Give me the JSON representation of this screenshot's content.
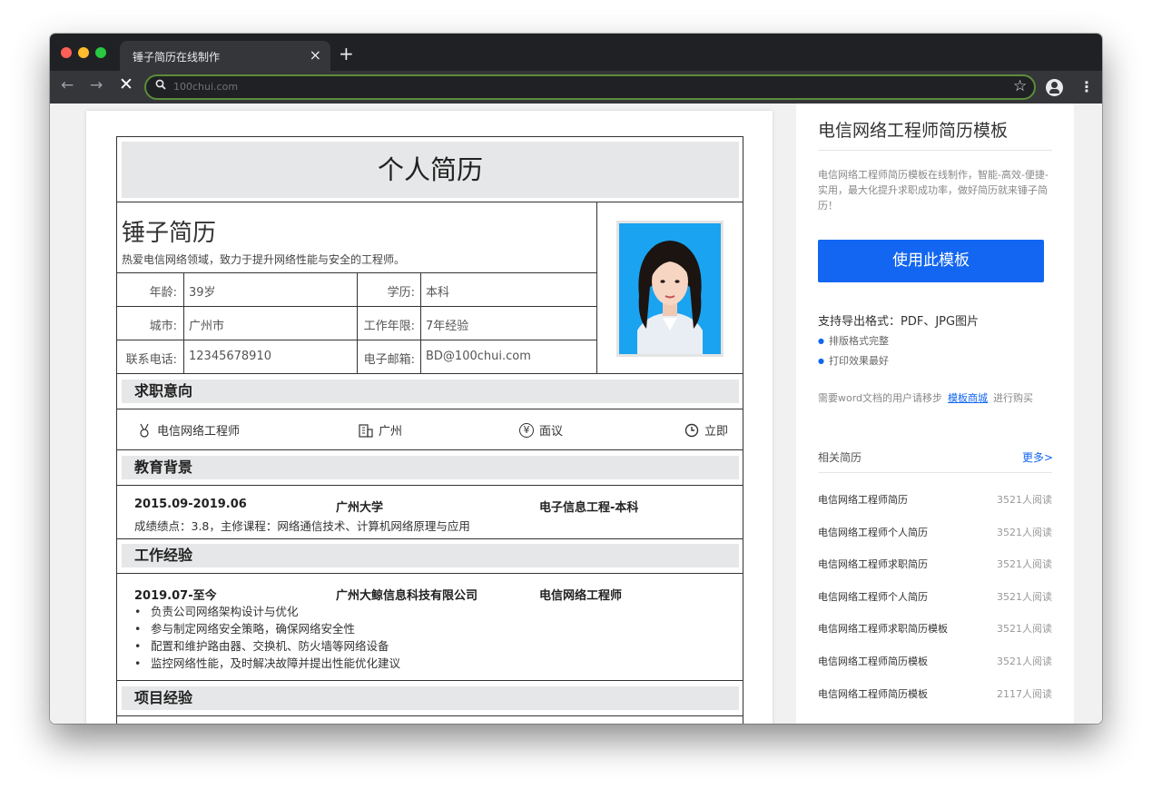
{
  "browser": {
    "tab_title": "锤子简历在线制作",
    "tab_close": "×",
    "new_tab": "+",
    "back": "←",
    "forward": "→",
    "stop": "✕",
    "search_glyph": "🔍",
    "url": "100chui.com",
    "star": "☆",
    "menu": "⋮"
  },
  "resume": {
    "title": "个人简历",
    "name": "锤子简历",
    "motto": "热爱电信网络领域，致力于提升网络性能与安全的工程师。",
    "info": [
      {
        "label": "年龄:",
        "value": "39岁"
      },
      {
        "label": "学历:",
        "value": "本科"
      },
      {
        "label": "城市:",
        "value": "广州市"
      },
      {
        "label": "工作年限:",
        "value": "7年经验"
      },
      {
        "label": "联系电话:",
        "value": "12345678910"
      },
      {
        "label": "电子邮箱:",
        "value": "BD@100chui.com"
      }
    ],
    "sections": {
      "intent": "求职意向",
      "education": "教育背景",
      "work": "工作经验",
      "project": "项目经验"
    },
    "intent": {
      "position": "电信网络工程师",
      "city": "广州",
      "salary": "面议",
      "start": "立即"
    },
    "education": {
      "period": "2015.09-2019.06",
      "school": "广州大学",
      "major": "电子信息工程-本科",
      "detail": "成绩绩点：3.8，主修课程：网络通信技术、计算机网络原理与应用"
    },
    "work": {
      "period": "2019.07-至今",
      "company": "广州大鲸信息科技有限公司",
      "role": "电信网络工程师",
      "duties": [
        "负责公司网络架构设计与优化",
        "参与制定网络安全策略，确保网络安全性",
        "配置和维护路由器、交换机、防火墙等网络设备",
        "监控网络性能，及时解决故障并提出性能优化建议"
      ]
    }
  },
  "sidebar": {
    "title": "电信网络工程师简历模板",
    "description": "电信网络工程师简历模板在线制作，智能-高效-便捷-实用，最大化提升求职成功率，做好简历就来锤子简历！",
    "use_button": "使用此模板",
    "formats": "支持导出格式：PDF、JPG图片",
    "features": [
      "排版格式完整",
      "打印效果最好"
    ],
    "note_before": "需要word文档的用户请移步",
    "note_link": "模板商城",
    "note_after": "进行购买",
    "related_title": "相关简历",
    "more": "更多>",
    "related": [
      {
        "title": "电信网络工程师简历",
        "reads": "3521人阅读"
      },
      {
        "title": "电信网络工程师个人简历",
        "reads": "3521人阅读"
      },
      {
        "title": "电信网络工程师求职简历",
        "reads": "3521人阅读"
      },
      {
        "title": "电信网络工程师个人简历",
        "reads": "3521人阅读"
      },
      {
        "title": "电信网络工程师求职简历模板",
        "reads": "3521人阅读"
      },
      {
        "title": "电信网络工程师简历模板",
        "reads": "3521人阅读"
      },
      {
        "title": "电信网络工程师简历模板",
        "reads": "2117人阅读"
      }
    ]
  },
  "colors": {
    "accent": "#1266f1",
    "section_bg": "#e6e7e8",
    "chrome_dark": "#202124",
    "chrome_mid": "#35363a"
  }
}
